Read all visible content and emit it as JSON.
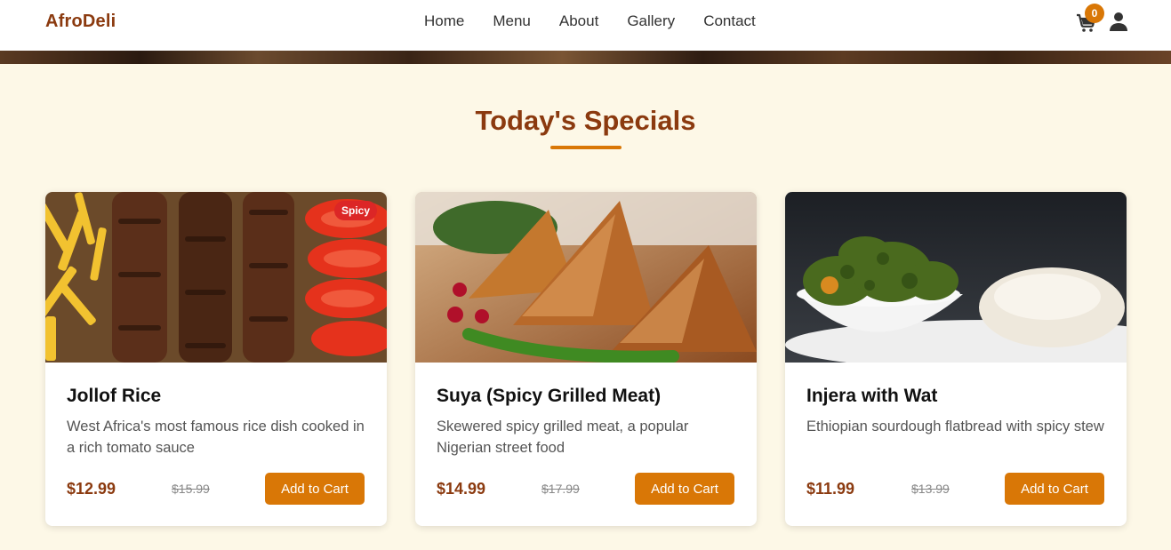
{
  "header": {
    "brand": "AfroDeli",
    "nav": [
      {
        "label": "Home"
      },
      {
        "label": "Menu"
      },
      {
        "label": "About"
      },
      {
        "label": "Gallery"
      },
      {
        "label": "Contact"
      }
    ],
    "cart_count": "0",
    "icons": {
      "cart": "shopping-cart-icon",
      "user": "user-icon"
    }
  },
  "specials": {
    "title": "Today's Specials",
    "items": [
      {
        "name": "Jollof Rice",
        "description": "West Africa's most famous rice dish cooked in a rich tomato sauce",
        "price": "$12.99",
        "old_price": "$15.99",
        "badge": "Spicy",
        "button": "Add to Cart"
      },
      {
        "name": "Suya (Spicy Grilled Meat)",
        "description": "Skewered spicy grilled meat, a popular Nigerian street food",
        "price": "$14.99",
        "old_price": "$17.99",
        "button": "Add to Cart"
      },
      {
        "name": "Injera with Wat",
        "description": "Ethiopian sourdough flatbread with spicy stew",
        "price": "$11.99",
        "old_price": "$13.99",
        "button": "Add to Cart"
      }
    ]
  },
  "colors": {
    "brand": "#8b3a0f",
    "accent": "#d97706",
    "background": "#fdf8e7",
    "badge": "#dc2626"
  }
}
